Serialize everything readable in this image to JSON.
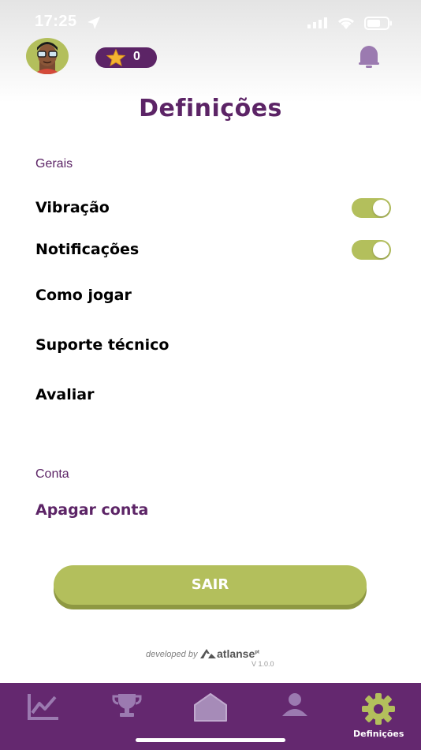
{
  "status_bar": {
    "time": "17:25"
  },
  "header": {
    "score": "0"
  },
  "page": {
    "title": "Definições"
  },
  "general": {
    "section_label": "Gerais",
    "vibration_label": "Vibração",
    "notifications_label": "Notificações",
    "how_to_play_label": "Como jogar",
    "support_label": "Suporte técnico",
    "rate_label": "Avaliar"
  },
  "account": {
    "section_label": "Conta",
    "delete_label": "Apagar conta"
  },
  "actions": {
    "exit_label": "SAIR"
  },
  "footer": {
    "developed_by": "developed by",
    "brand": "atlanse",
    "brand_sup": "pt",
    "version": "V 1.0.0"
  },
  "nav": {
    "active_label": "Definições"
  },
  "toggles": {
    "vibration": true,
    "notifications": true
  },
  "colors": {
    "primary": "#5c2466",
    "accent": "#b3bf5c",
    "nav_bg": "#64286f"
  }
}
